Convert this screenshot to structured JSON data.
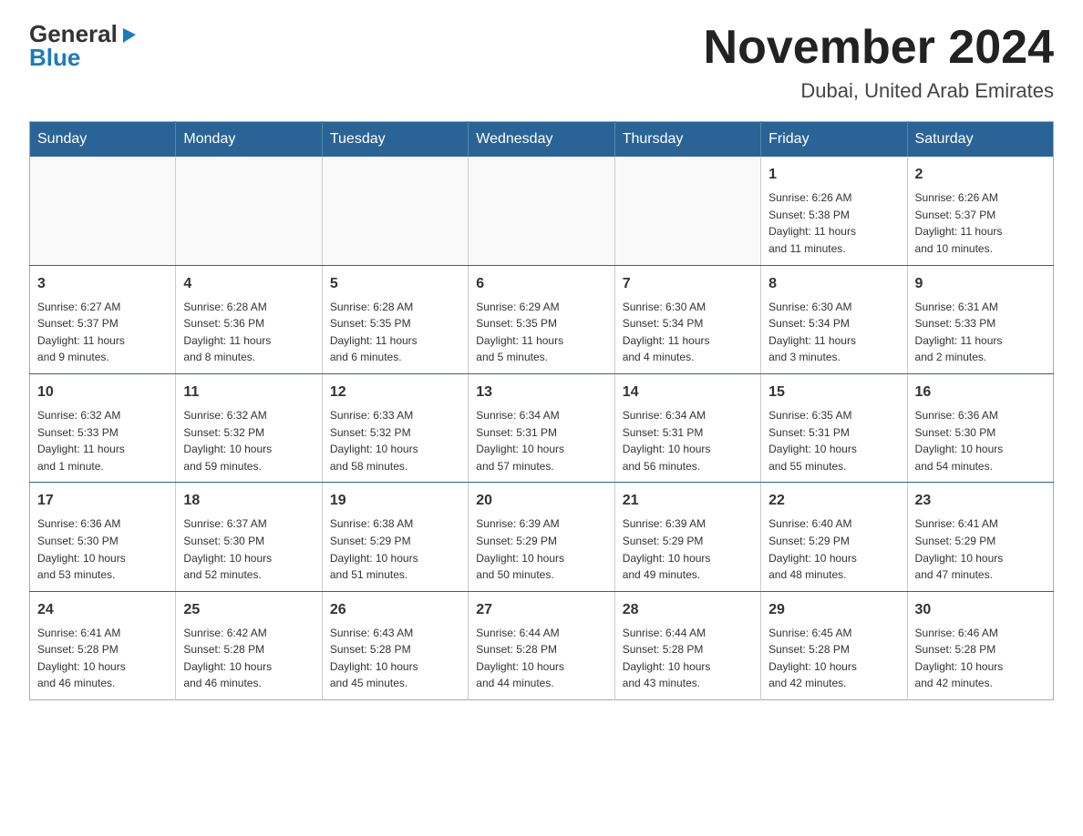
{
  "logo": {
    "general": "General",
    "blue": "Blue",
    "arrow": "▶"
  },
  "title": "November 2024",
  "location": "Dubai, United Arab Emirates",
  "weekdays": [
    "Sunday",
    "Monday",
    "Tuesday",
    "Wednesday",
    "Thursday",
    "Friday",
    "Saturday"
  ],
  "weeks": [
    [
      {
        "day": "",
        "info": ""
      },
      {
        "day": "",
        "info": ""
      },
      {
        "day": "",
        "info": ""
      },
      {
        "day": "",
        "info": ""
      },
      {
        "day": "",
        "info": ""
      },
      {
        "day": "1",
        "info": "Sunrise: 6:26 AM\nSunset: 5:38 PM\nDaylight: 11 hours\nand 11 minutes."
      },
      {
        "day": "2",
        "info": "Sunrise: 6:26 AM\nSunset: 5:37 PM\nDaylight: 11 hours\nand 10 minutes."
      }
    ],
    [
      {
        "day": "3",
        "info": "Sunrise: 6:27 AM\nSunset: 5:37 PM\nDaylight: 11 hours\nand 9 minutes."
      },
      {
        "day": "4",
        "info": "Sunrise: 6:28 AM\nSunset: 5:36 PM\nDaylight: 11 hours\nand 8 minutes."
      },
      {
        "day": "5",
        "info": "Sunrise: 6:28 AM\nSunset: 5:35 PM\nDaylight: 11 hours\nand 6 minutes."
      },
      {
        "day": "6",
        "info": "Sunrise: 6:29 AM\nSunset: 5:35 PM\nDaylight: 11 hours\nand 5 minutes."
      },
      {
        "day": "7",
        "info": "Sunrise: 6:30 AM\nSunset: 5:34 PM\nDaylight: 11 hours\nand 4 minutes."
      },
      {
        "day": "8",
        "info": "Sunrise: 6:30 AM\nSunset: 5:34 PM\nDaylight: 11 hours\nand 3 minutes."
      },
      {
        "day": "9",
        "info": "Sunrise: 6:31 AM\nSunset: 5:33 PM\nDaylight: 11 hours\nand 2 minutes."
      }
    ],
    [
      {
        "day": "10",
        "info": "Sunrise: 6:32 AM\nSunset: 5:33 PM\nDaylight: 11 hours\nand 1 minute."
      },
      {
        "day": "11",
        "info": "Sunrise: 6:32 AM\nSunset: 5:32 PM\nDaylight: 10 hours\nand 59 minutes."
      },
      {
        "day": "12",
        "info": "Sunrise: 6:33 AM\nSunset: 5:32 PM\nDaylight: 10 hours\nand 58 minutes."
      },
      {
        "day": "13",
        "info": "Sunrise: 6:34 AM\nSunset: 5:31 PM\nDaylight: 10 hours\nand 57 minutes."
      },
      {
        "day": "14",
        "info": "Sunrise: 6:34 AM\nSunset: 5:31 PM\nDaylight: 10 hours\nand 56 minutes."
      },
      {
        "day": "15",
        "info": "Sunrise: 6:35 AM\nSunset: 5:31 PM\nDaylight: 10 hours\nand 55 minutes."
      },
      {
        "day": "16",
        "info": "Sunrise: 6:36 AM\nSunset: 5:30 PM\nDaylight: 10 hours\nand 54 minutes."
      }
    ],
    [
      {
        "day": "17",
        "info": "Sunrise: 6:36 AM\nSunset: 5:30 PM\nDaylight: 10 hours\nand 53 minutes."
      },
      {
        "day": "18",
        "info": "Sunrise: 6:37 AM\nSunset: 5:30 PM\nDaylight: 10 hours\nand 52 minutes."
      },
      {
        "day": "19",
        "info": "Sunrise: 6:38 AM\nSunset: 5:29 PM\nDaylight: 10 hours\nand 51 minutes."
      },
      {
        "day": "20",
        "info": "Sunrise: 6:39 AM\nSunset: 5:29 PM\nDaylight: 10 hours\nand 50 minutes."
      },
      {
        "day": "21",
        "info": "Sunrise: 6:39 AM\nSunset: 5:29 PM\nDaylight: 10 hours\nand 49 minutes."
      },
      {
        "day": "22",
        "info": "Sunrise: 6:40 AM\nSunset: 5:29 PM\nDaylight: 10 hours\nand 48 minutes."
      },
      {
        "day": "23",
        "info": "Sunrise: 6:41 AM\nSunset: 5:29 PM\nDaylight: 10 hours\nand 47 minutes."
      }
    ],
    [
      {
        "day": "24",
        "info": "Sunrise: 6:41 AM\nSunset: 5:28 PM\nDaylight: 10 hours\nand 46 minutes."
      },
      {
        "day": "25",
        "info": "Sunrise: 6:42 AM\nSunset: 5:28 PM\nDaylight: 10 hours\nand 46 minutes."
      },
      {
        "day": "26",
        "info": "Sunrise: 6:43 AM\nSunset: 5:28 PM\nDaylight: 10 hours\nand 45 minutes."
      },
      {
        "day": "27",
        "info": "Sunrise: 6:44 AM\nSunset: 5:28 PM\nDaylight: 10 hours\nand 44 minutes."
      },
      {
        "day": "28",
        "info": "Sunrise: 6:44 AM\nSunset: 5:28 PM\nDaylight: 10 hours\nand 43 minutes."
      },
      {
        "day": "29",
        "info": "Sunrise: 6:45 AM\nSunset: 5:28 PM\nDaylight: 10 hours\nand 42 minutes."
      },
      {
        "day": "30",
        "info": "Sunrise: 6:46 AM\nSunset: 5:28 PM\nDaylight: 10 hours\nand 42 minutes."
      }
    ]
  ]
}
